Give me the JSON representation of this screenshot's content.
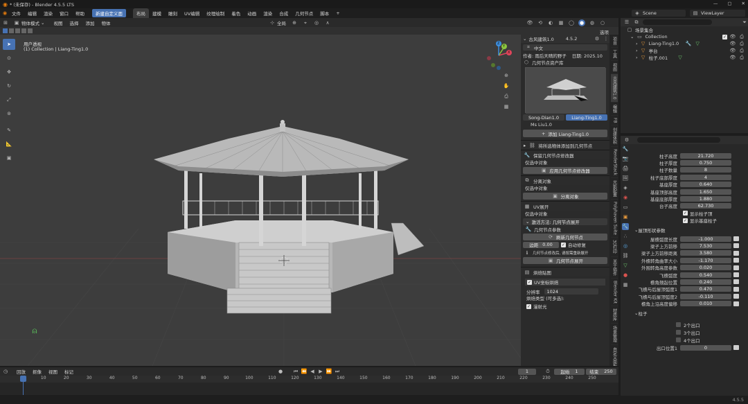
{
  "window": {
    "title": "* (未保存) - Blender 4.5.5 LTS"
  },
  "topbar": {
    "menus": [
      "文件",
      "编辑",
      "渲染",
      "窗口",
      "帮助"
    ],
    "active_tool_btn": "新建自定义面",
    "workspaces": [
      "布局",
      "建模",
      "雕刻",
      "UV编辑",
      "纹理绘制",
      "着色",
      "动画",
      "渲染",
      "合成",
      "几何节点",
      "脚本"
    ],
    "add_tab": "+",
    "scene_label": "Scene",
    "viewlayer_label": "ViewLayer"
  },
  "viewport_header": {
    "mode": "物体模式",
    "menus": [
      "视图",
      "选择",
      "添加",
      "物体"
    ],
    "transform": "全局",
    "options_label": "选项"
  },
  "viewport": {
    "view_name": "用户透视",
    "collection_line": "(1) Collection | Liang-Ting1.0",
    "gizmo": {
      "x": "X",
      "y": "Y",
      "z": "Z"
    }
  },
  "npanel": {
    "header_title": "古风建筑1.0",
    "version": "4.5.2",
    "language": "中文",
    "author_line": "作者: 雨后天晴的野子",
    "date_line": "日期: 2025.10",
    "asset_category": "几何节点资产库",
    "assets": [
      {
        "label": "Song-Dian1.0",
        "active": false
      },
      {
        "label": "Liang-Ting1.0",
        "active": true
      }
    ],
    "preview_sub": "Ms  Liu1.0",
    "add_btn": "添加 Liang-Ting1.0",
    "sections": {
      "node_to_geo": "将所选物体添加到几何节点",
      "tone_panel": "保留几何节点修改器",
      "select_one": "仅选中对象",
      "apply_btn": "应用几何节点修改器",
      "split_panel": "分离对象",
      "select_one2": "仅选中对象",
      "split_btn": "分离对象",
      "uv_panel": "UV展开",
      "select_one3": "仅选中对象",
      "uv_method": "激活方法: 几何节点展开",
      "geo_params": "几何节点参数",
      "refresh_btn": "刷新几何节点",
      "merge_label": "边距",
      "merge_value": "0.00",
      "auto_check": "自动修复",
      "warn_text": "几何节点修改后, 请按需重新展开",
      "geo_expand_btn": "几何节点展开",
      "bake_panel": "烘焙贴图",
      "uv_bake": "UV坐标烘焙",
      "resolution_label": "分辨率",
      "resolution_value": "1024",
      "bake_type": "烘焙类型 (可多选):",
      "ao_check": "漫射光"
    }
  },
  "vertical_tabs": [
    "项目",
    "工具",
    "视图",
    "古风建筑1.0",
    "编辑",
    "FB",
    "创建体积",
    "RenderStack",
    "光影配置",
    "Polyhaven Suite",
    "3D打印",
    "关于插件",
    "Blender Kit",
    "材质库",
    "场景管理",
    "自定义面板VoxelHeart"
  ],
  "outliner": {
    "scene_collection": "场景集合",
    "items": [
      {
        "label": "Collection",
        "depth": 0
      },
      {
        "label": "Liang-Ting1.0",
        "depth": 1
      },
      {
        "label": "亭台",
        "depth": 1
      },
      {
        "label": "柱子.001",
        "depth": 1
      }
    ]
  },
  "properties": {
    "rows_top": [
      {
        "label": "柱子高度",
        "value": "21.720"
      },
      {
        "label": "柱子厚度",
        "value": "0.750"
      },
      {
        "label": "柱子数量",
        "value": "8"
      },
      {
        "label": "柱子底部厚度",
        "value": "4"
      },
      {
        "label": "基座厚度",
        "value": "0.640"
      },
      {
        "label": "基座顶部高度",
        "value": "1.650"
      },
      {
        "label": "基座底部厚度",
        "value": "1.880"
      },
      {
        "label": "台子高度",
        "value": "62.730"
      }
    ],
    "checks_top": [
      "显示柱子顶",
      "显示基座柱子"
    ],
    "section_roof": "屋顶形状参数",
    "rows_roof": [
      {
        "label": "屋檐弧度长度",
        "value": "-1.000"
      },
      {
        "label": "梁子上方前移",
        "value": "7.530"
      },
      {
        "label": "梁子上方前移距离",
        "value": "3.580"
      },
      {
        "label": "外檐转角曲率大小",
        "value": "-1.170"
      },
      {
        "label": "外围转角高度参数",
        "value": "0.020"
      },
      {
        "label": "飞檐弧度",
        "value": "0.540"
      },
      {
        "label": "檐角翘起位置",
        "value": "0.240"
      },
      {
        "label": "飞檐与后屋顶弧度1",
        "value": "0.470"
      },
      {
        "label": "飞檐与后屋顶弧度2",
        "value": "-0.110"
      },
      {
        "label": "檐角上沿高度偏移",
        "value": "0.010"
      }
    ],
    "section_pillar": "柱子",
    "exits": [
      "2个出口",
      "3个出口",
      "4个出口"
    ],
    "exit_position_label": "出口位置1",
    "exit_position_value": "0"
  },
  "timeline": {
    "menus": [
      "回放",
      "抠像",
      "视图",
      "标记"
    ],
    "current_frame": "1",
    "start_label": "起始",
    "start_value": "1",
    "end_label": "结束",
    "end_value": "250",
    "ticks": [
      "1",
      "10",
      "20",
      "30",
      "40",
      "50",
      "60",
      "70",
      "80",
      "90",
      "100",
      "110",
      "120",
      "130",
      "140",
      "150",
      "160",
      "170",
      "180",
      "190",
      "200",
      "210",
      "220",
      "230",
      "240",
      "250"
    ]
  },
  "statusbar": {
    "version": "4.5.5"
  }
}
